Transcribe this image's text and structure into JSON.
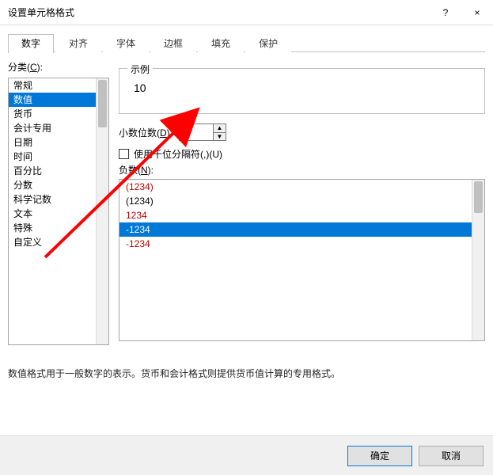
{
  "window": {
    "title": "设置单元格格式",
    "help_symbol": "?",
    "close_symbol": "×"
  },
  "tabs": [
    {
      "label": "数字",
      "active": true
    },
    {
      "label": "对齐",
      "active": false
    },
    {
      "label": "字体",
      "active": false
    },
    {
      "label": "边框",
      "active": false
    },
    {
      "label": "填充",
      "active": false
    },
    {
      "label": "保护",
      "active": false
    }
  ],
  "category": {
    "label_prefix": "分类(",
    "label_hotkey": "C",
    "label_suffix": "):",
    "items": [
      {
        "label": "常规",
        "selected": false
      },
      {
        "label": "数值",
        "selected": true
      },
      {
        "label": "货币",
        "selected": false
      },
      {
        "label": "会计专用",
        "selected": false
      },
      {
        "label": "日期",
        "selected": false
      },
      {
        "label": "时间",
        "selected": false
      },
      {
        "label": "百分比",
        "selected": false
      },
      {
        "label": "分数",
        "selected": false
      },
      {
        "label": "科学记数",
        "selected": false
      },
      {
        "label": "文本",
        "selected": false
      },
      {
        "label": "特殊",
        "selected": false
      },
      {
        "label": "自定义",
        "selected": false
      }
    ]
  },
  "sample": {
    "legend": "示例",
    "value": "10"
  },
  "decimal": {
    "label_prefix": "小数位数(",
    "label_hotkey": "D",
    "label_suffix": "):",
    "value": "0"
  },
  "thousands": {
    "checked": false,
    "label_prefix": "使用千位分隔符(,)(",
    "label_hotkey": "U",
    "label_suffix": ")"
  },
  "negatives": {
    "label_prefix": "负数(",
    "label_hotkey": "N",
    "label_suffix": "):",
    "items": [
      {
        "text": "(1234)",
        "color": "red",
        "selected": false
      },
      {
        "text": "(1234)",
        "color": "black",
        "selected": false
      },
      {
        "text": "1234",
        "color": "red",
        "selected": false
      },
      {
        "text": "-1234",
        "color": "white",
        "selected": true
      },
      {
        "text": "-1234",
        "color": "red",
        "selected": false
      }
    ]
  },
  "description": "数值格式用于一般数字的表示。货币和会计格式则提供货币值计算的专用格式。",
  "buttons": {
    "ok": "确定",
    "cancel": "取消"
  },
  "colors": {
    "red": "#c00000",
    "selection": "#0078d7"
  }
}
